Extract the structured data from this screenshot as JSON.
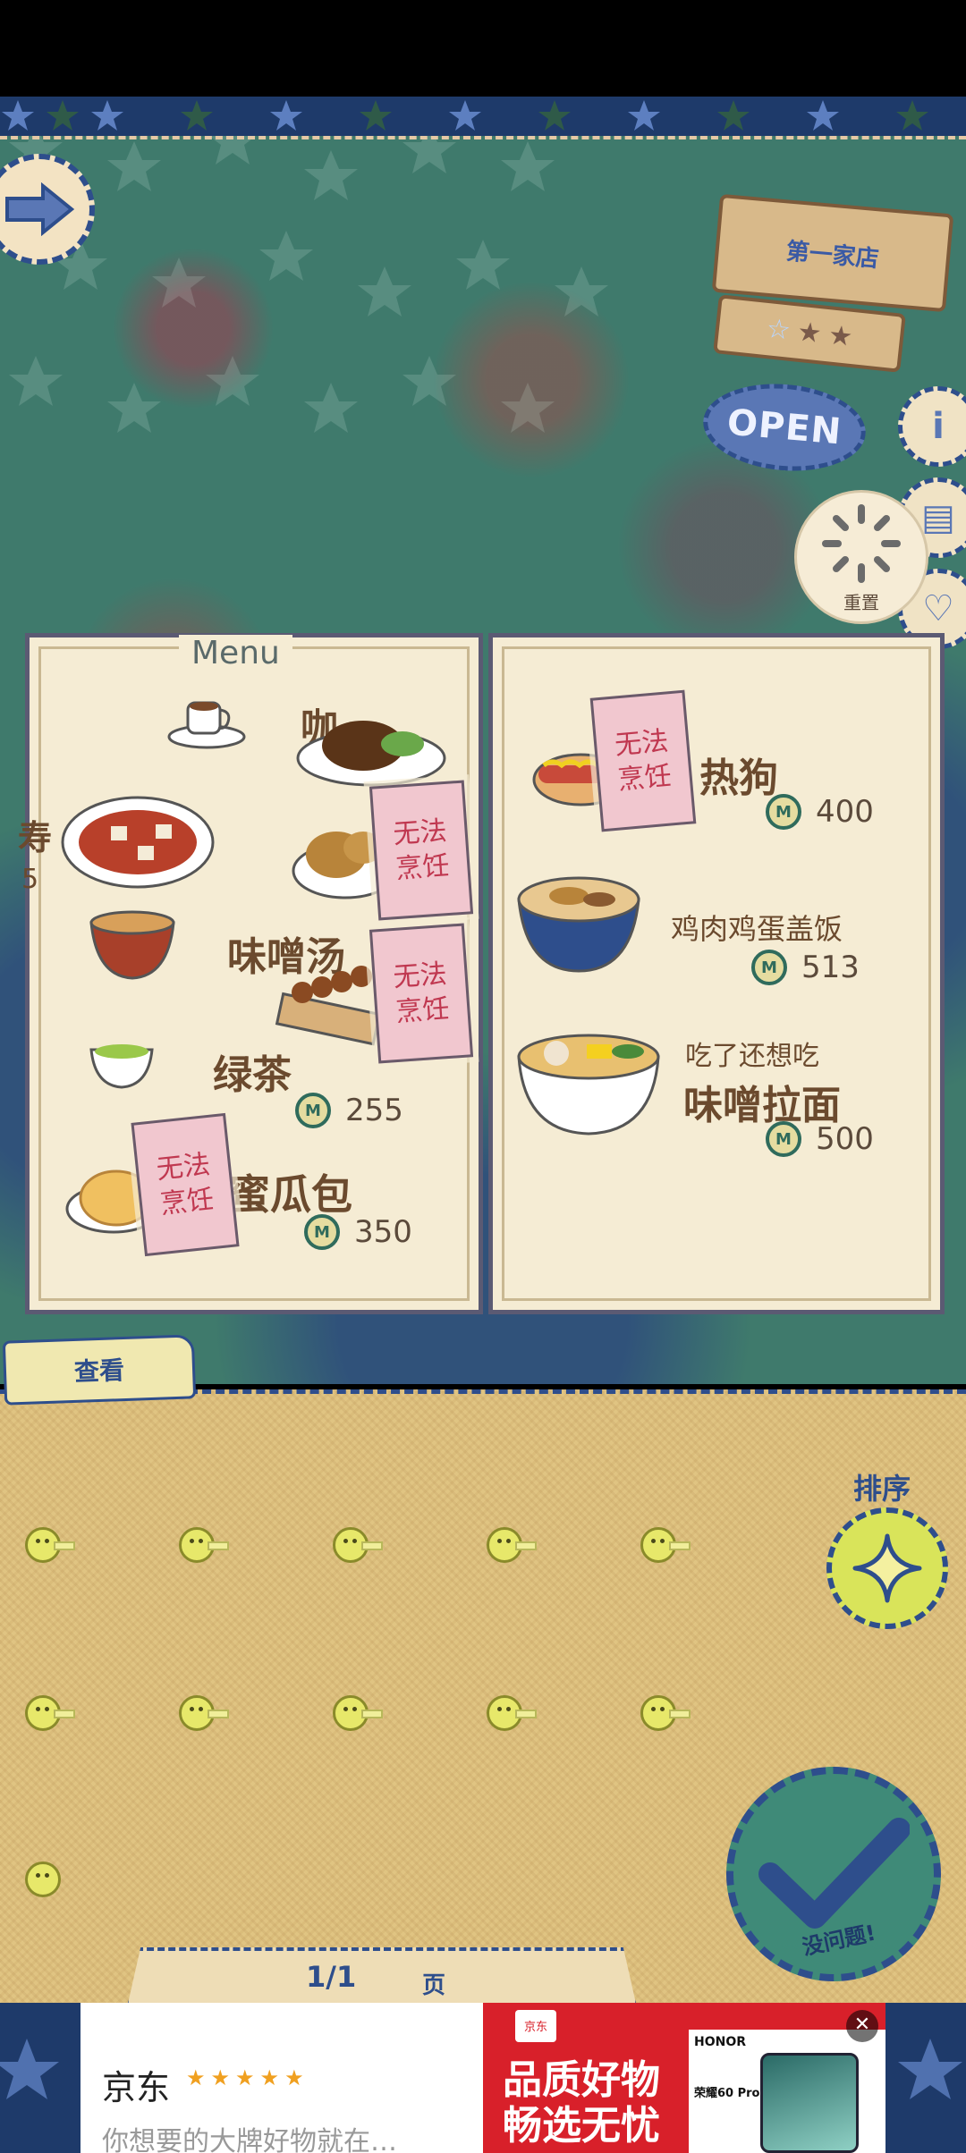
{
  "shop": {
    "sign": "第一家店",
    "stars": [
      "☆",
      "★",
      "★"
    ],
    "open_label": "OPEN",
    "side_buttons": [
      {
        "name": "info-icon",
        "glyph": "i"
      },
      {
        "name": "book-icon",
        "glyph": "▤"
      },
      {
        "name": "heart-icon",
        "glyph": "♡"
      }
    ],
    "reset_label": "重置"
  },
  "menu": {
    "title": "Menu",
    "left_page": {
      "dish_coffee_partial": "咖",
      "dish_green_tea": "绿茶",
      "price_green_tea": "255",
      "dish_melon_bread": "蜜瓜包",
      "price_melon_bread": "350",
      "dish_miso_soup": "味噌汤",
      "partial_left_char": "寿",
      "partial_left_num": "5"
    },
    "right_page": {
      "dish_hotdog": "热狗",
      "price_hotdog": "400",
      "dish_oyakodon": "鸡肉鸡蛋盖饭",
      "price_oyakodon": "513",
      "ramen_caption": "吃了还想吃",
      "dish_ramen": "味噌拉面",
      "price_ramen": "500"
    },
    "cannot_cook": [
      "无法",
      "烹饪"
    ]
  },
  "inventory": {
    "view_tab": "查看",
    "sort_label": "排序",
    "ok_label": "没问题!",
    "page_indicator": "1/1",
    "page_unit": "页",
    "slot_count": 11
  },
  "ad": {
    "brand": "京东",
    "stars": "★★★★★",
    "subtitle": "你想要的大牌好物就在…",
    "slogan_line1": "品质好物",
    "slogan_line2": "畅选无忧",
    "logo": "京东",
    "phone_brand": "HONOR",
    "phone_model": "荣耀60 Pro",
    "close": "✕"
  },
  "colors": {
    "navy_stitch": "#2e4e8c",
    "paper": "#f5ecd4",
    "stamp_pink": "#f1c7cf",
    "stamp_text": "#c03850",
    "coin_green": "#2f6b5c"
  }
}
